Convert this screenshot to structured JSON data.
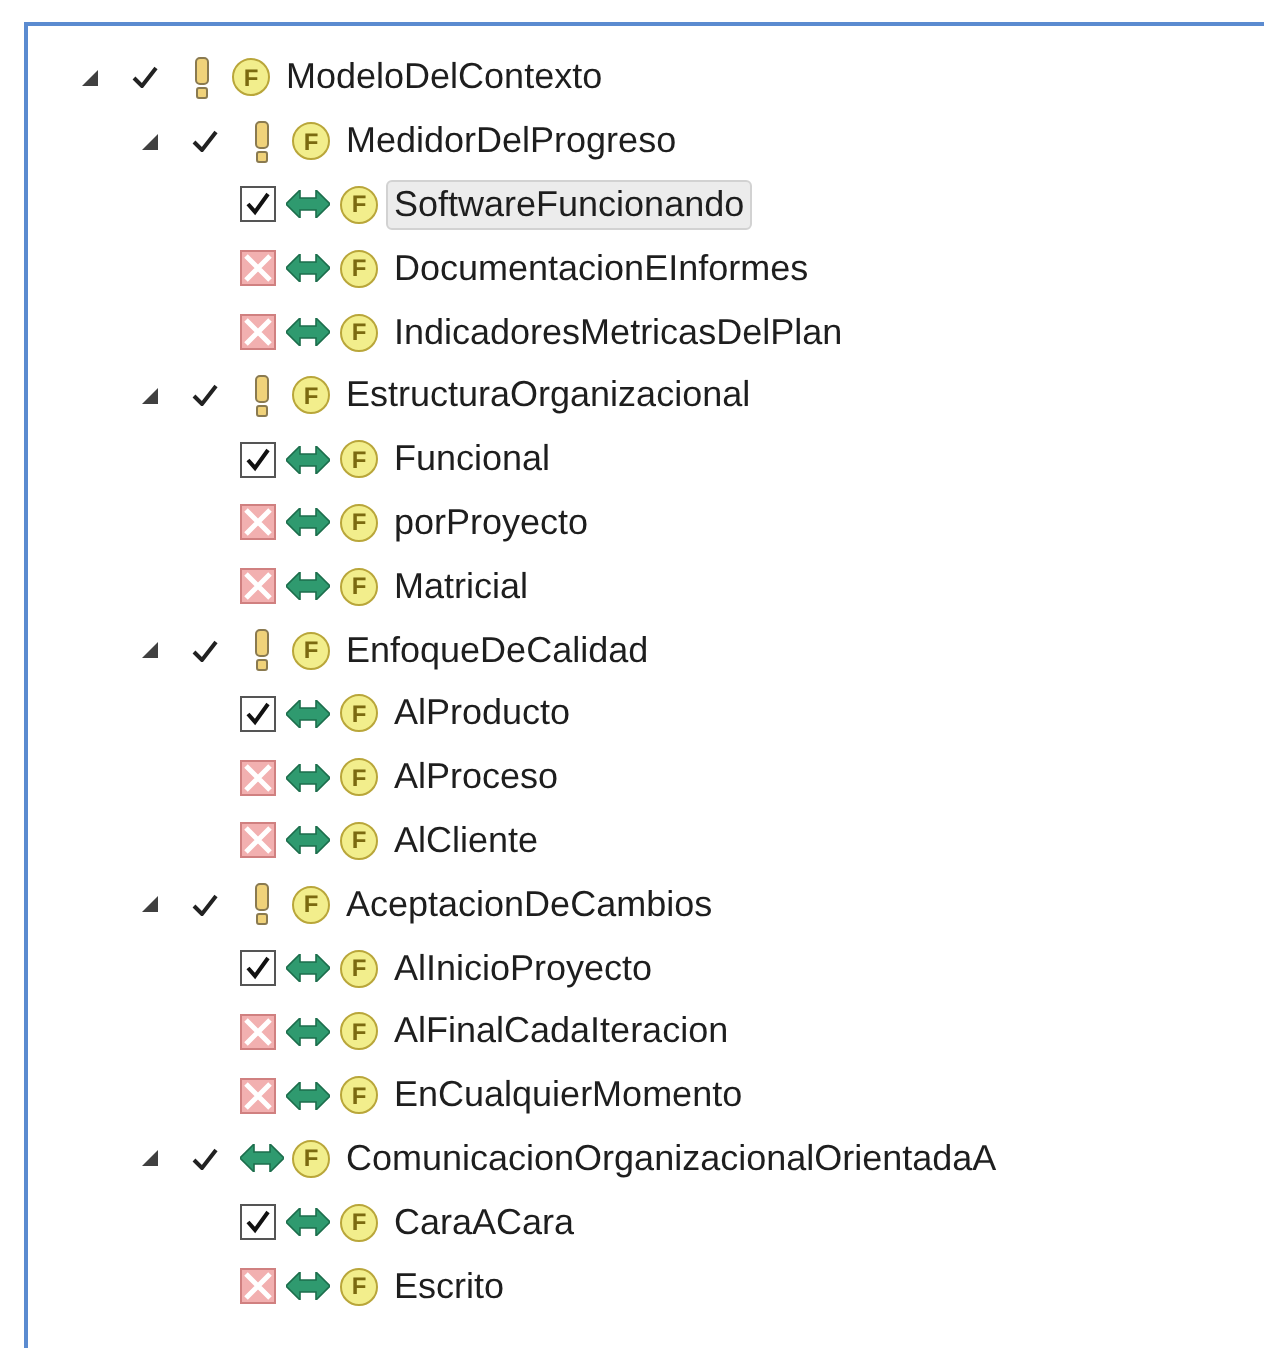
{
  "tree": [
    {
      "kind": "mandatory",
      "label": "ModeloDelContexto",
      "badge": "F",
      "expanded": true,
      "checked": true,
      "children": [
        {
          "kind": "mandatory",
          "label": "MedidorDelProgreso",
          "badge": "F",
          "expanded": true,
          "checked": true,
          "children": [
            {
              "kind": "leaf",
              "label": "SoftwareFuncionando",
              "badge": "F",
              "checked": true,
              "selected": true
            },
            {
              "kind": "leaf",
              "label": "DocumentacionEInformes",
              "badge": "F",
              "checked": false,
              "selected": false
            },
            {
              "kind": "leaf",
              "label": "IndicadoresMetricasDelPlan",
              "badge": "F",
              "checked": false,
              "selected": false
            }
          ]
        },
        {
          "kind": "mandatory",
          "label": "EstructuraOrganizacional",
          "badge": "F",
          "expanded": true,
          "checked": true,
          "children": [
            {
              "kind": "leaf",
              "label": "Funcional",
              "badge": "F",
              "checked": true,
              "selected": false
            },
            {
              "kind": "leaf",
              "label": "porProyecto",
              "badge": "F",
              "checked": false,
              "selected": false
            },
            {
              "kind": "leaf",
              "label": "Matricial",
              "badge": "F",
              "checked": false,
              "selected": false
            }
          ]
        },
        {
          "kind": "mandatory",
          "label": "EnfoqueDeCalidad",
          "badge": "F",
          "expanded": true,
          "checked": true,
          "children": [
            {
              "kind": "leaf",
              "label": "AlProducto",
              "badge": "F",
              "checked": true,
              "selected": false
            },
            {
              "kind": "leaf",
              "label": "AlProceso",
              "badge": "F",
              "checked": false,
              "selected": false
            },
            {
              "kind": "leaf",
              "label": "AlCliente",
              "badge": "F",
              "checked": false,
              "selected": false
            }
          ]
        },
        {
          "kind": "mandatory",
          "label": "AceptacionDeCambios",
          "badge": "F",
          "expanded": true,
          "checked": true,
          "children": [
            {
              "kind": "leaf",
              "label": "AlInicioProyecto",
              "badge": "F",
              "checked": true,
              "selected": false
            },
            {
              "kind": "leaf",
              "label": "AlFinalCadaIteracion",
              "badge": "F",
              "checked": false,
              "selected": false
            },
            {
              "kind": "leaf",
              "label": "EnCualquierMomento",
              "badge": "F",
              "checked": false,
              "selected": false
            }
          ]
        },
        {
          "kind": "alternative",
          "label": "ComunicacionOrganizacionalOrientadaA",
          "badge": "F",
          "expanded": true,
          "checked": true,
          "children": [
            {
              "kind": "leaf",
              "label": "CaraACara",
              "badge": "F",
              "checked": true,
              "selected": false
            },
            {
              "kind": "leaf",
              "label": "Escrito",
              "badge": "F",
              "checked": false,
              "selected": false
            }
          ]
        }
      ]
    }
  ]
}
